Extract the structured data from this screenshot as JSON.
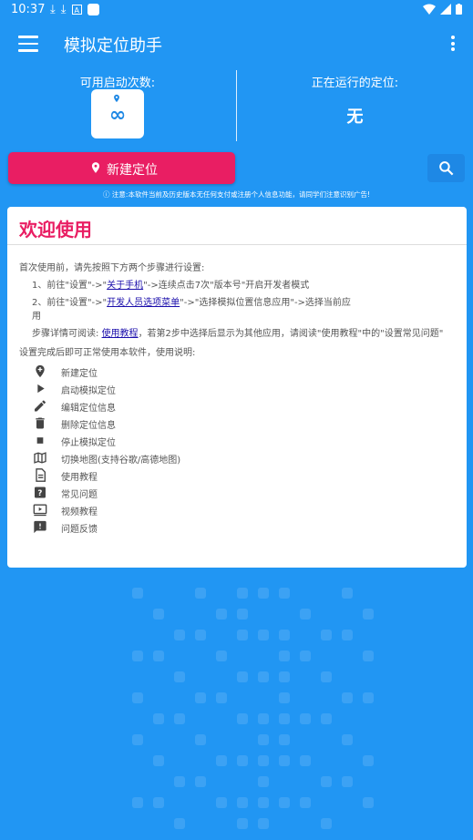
{
  "status_bar": {
    "time": "10:37"
  },
  "app_bar": {
    "title": "模拟定位助手"
  },
  "stats": {
    "left_label": "可用启动次数:",
    "count": "∞",
    "right_label": "正在运行的定位:",
    "running": "无"
  },
  "actions": {
    "new_location": "新建定位"
  },
  "notice": "ⓘ  注意:本软件当前及历史版本无任何支付或注册个人信息功能，请同学们注意识别广告!",
  "welcome": {
    "title": "欢迎使用",
    "intro": "首次使用前，请先按照下方两个步骤进行设置:",
    "step1": {
      "prefix": "1、前往\"设置\"->\"",
      "link": "关于手机",
      "suffix": "\"->连续点击7次\"版本号\"开启开发者模式"
    },
    "step2": {
      "prefix": "2、前往\"设置\"->\"",
      "link": "开发人员选项菜单",
      "suffix": "\"->\"选择模拟位置信息应用\"->选择当前应",
      "line2": "用"
    },
    "detail": {
      "prefix": "步骤详情可阅读: ",
      "link": "使用教程",
      "suffix": "，若第2步中选择后显示为其他应用，请阅读\"使用教程\"中的\"设置常见问题\""
    },
    "usage_intro": "设置完成后即可正常使用本软件，使用说明:",
    "legend": [
      {
        "icon": "add-location-icon",
        "label": "新建定位"
      },
      {
        "icon": "play-icon",
        "label": "启动模拟定位"
      },
      {
        "icon": "edit-icon",
        "label": "编辑定位信息"
      },
      {
        "icon": "delete-icon",
        "label": "删除定位信息"
      },
      {
        "icon": "stop-icon",
        "label": "停止模拟定位"
      },
      {
        "icon": "map-icon",
        "label": "切换地图(支持谷歌/高德地图)"
      },
      {
        "icon": "document-icon",
        "label": "使用教程"
      },
      {
        "icon": "help-icon",
        "label": "常见问题"
      },
      {
        "icon": "video-icon",
        "label": "视频教程"
      },
      {
        "icon": "feedback-icon",
        "label": "问题反馈"
      }
    ]
  },
  "colors": {
    "background": "#2196f3",
    "accent": "#e91e63",
    "card": "#ffffff"
  }
}
